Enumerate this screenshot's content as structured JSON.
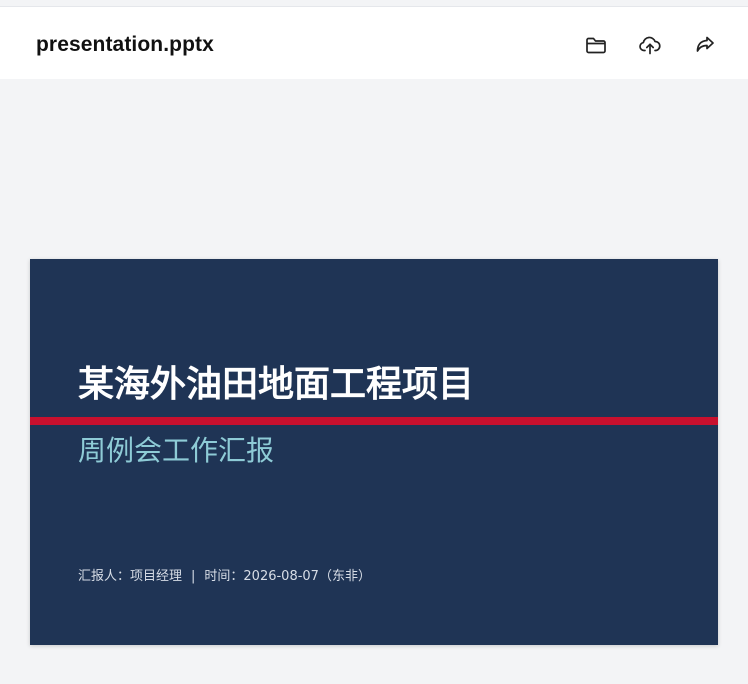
{
  "header": {
    "file_name": "presentation.pptx",
    "icons": [
      "folder-icon",
      "upload-icon",
      "share-icon"
    ]
  },
  "slide": {
    "title": "某海外油田地面工程项目",
    "subtitle": "周例会工作汇报",
    "reporter": "汇报人：项目经理",
    "separator": "|",
    "time": "时间：2026-08-07（东非）",
    "colors": {
      "background": "#1f3455",
      "rule": "#c8102e",
      "subtitle": "#8ecbd6"
    }
  }
}
